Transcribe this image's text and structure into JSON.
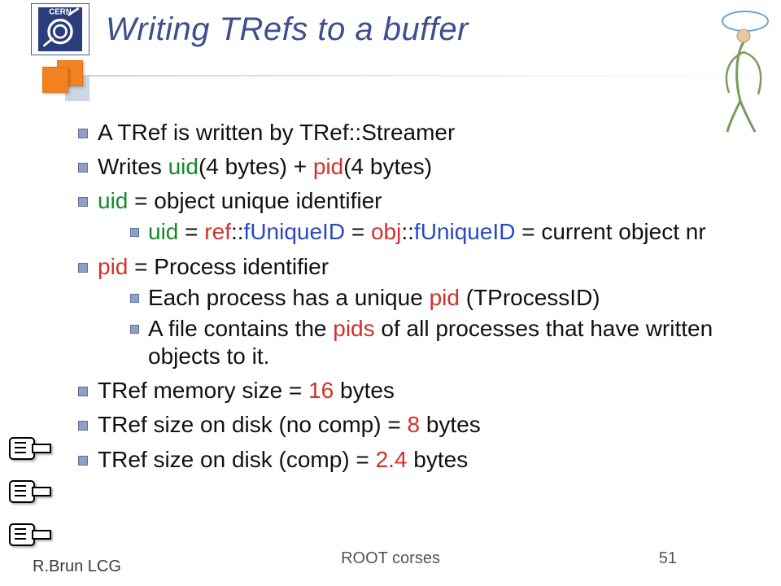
{
  "title": "Writing TRefs to a buffer",
  "b1": "A TRef is written by TRef::Streamer",
  "b2": {
    "a": "Writes ",
    "uid": "uid",
    "b": "(4 bytes) + ",
    "pid": "pid",
    "c": "(4 bytes)"
  },
  "b3": {
    "uid": "uid",
    "rest": " = object unique identifier"
  },
  "b3_1": {
    "uid": "uid",
    "eq1": " = ",
    "ref": "ref",
    "fu1": "::",
    "fUniqueID1": "fUniqueID",
    "eq2": " = ",
    "obj": "obj",
    "fu2": "::",
    "fUniqueID2": "fUniqueID",
    "tail": " = current object nr"
  },
  "b4": {
    "pid": "pid",
    "rest": " = Process identifier"
  },
  "b4_1": {
    "a": "Each process has a unique ",
    "pid": "pid",
    "b": " (TProcessID)"
  },
  "b4_2": {
    "a": "A file contains the ",
    "pids": "pids",
    "b": " of all processes that have written objects to it."
  },
  "b5": {
    "a": "TRef memory size = ",
    "v": "16",
    "b": " bytes"
  },
  "b6": {
    "a": "TRef size on disk (no comp)  = ",
    "v": "8",
    "b": " bytes"
  },
  "b7": {
    "a": "TRef size on disk (comp) = ",
    "v": "2.4",
    "b": " bytes"
  },
  "footer": {
    "author": "R.Brun  LCG",
    "center": "ROOT corses",
    "page": "51"
  }
}
